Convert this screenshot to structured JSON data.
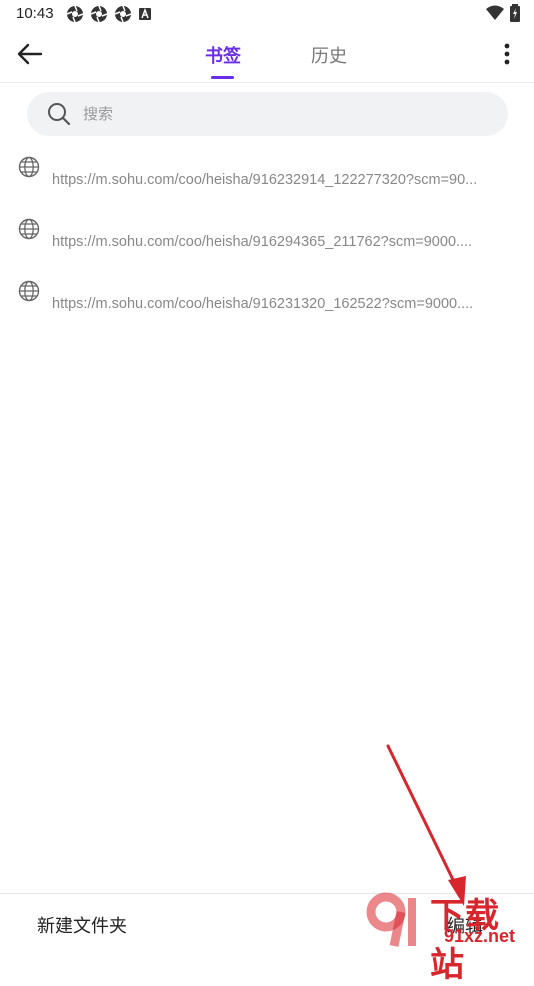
{
  "status_bar": {
    "time": "10:43"
  },
  "header": {
    "tabs": [
      {
        "label": "书签",
        "active": true
      },
      {
        "label": "历史",
        "active": false
      }
    ]
  },
  "search": {
    "placeholder": "搜索",
    "value": ""
  },
  "bookmarks": [
    {
      "url": "https://m.sohu.com/coo/heisha/916232914_122277320?scm=90..."
    },
    {
      "url": "https://m.sohu.com/coo/heisha/916294365_211762?scm=9000...."
    },
    {
      "url": "https://m.sohu.com/coo/heisha/916231320_162522?scm=9000...."
    }
  ],
  "bottom_bar": {
    "new_folder_label": "新建文件夹",
    "edit_label": "编辑"
  },
  "watermark": {
    "title": "下载站",
    "subtitle": "91xz.net"
  },
  "colors": {
    "accent": "#6b2ee8",
    "annotation_arrow": "#d8262d"
  },
  "icons": [
    "back-arrow-icon",
    "more-vertical-icon",
    "search-icon",
    "globe-icon"
  ]
}
